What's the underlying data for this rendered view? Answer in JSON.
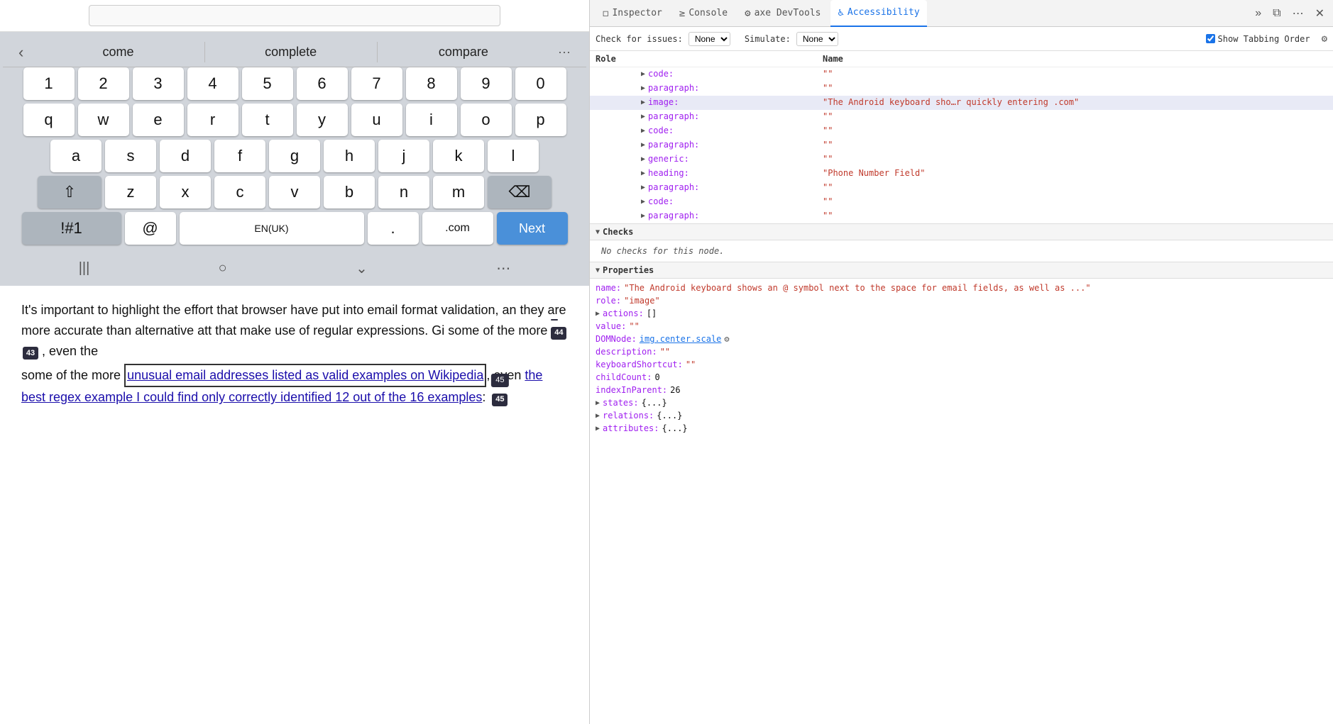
{
  "left": {
    "autocomplete": {
      "back_icon": "‹",
      "words": [
        "come",
        "complete",
        "compare"
      ],
      "more_icon": "···"
    },
    "keyboard": {
      "row1": [
        "1",
        "2",
        "3",
        "4",
        "5",
        "6",
        "7",
        "8",
        "9",
        "0"
      ],
      "row2": [
        "q",
        "w",
        "e",
        "r",
        "t",
        "y",
        "u",
        "i",
        "o",
        "p"
      ],
      "row3": [
        "a",
        "s",
        "d",
        "f",
        "g",
        "h",
        "j",
        "k",
        "l"
      ],
      "row4_special_left": "⇧",
      "row4": [
        "z",
        "x",
        "c",
        "v",
        "b",
        "n",
        "m"
      ],
      "row4_special_right": "⌫",
      "row5_special": "!#1",
      "row5_at": "@",
      "row5_space": "EN(UK)",
      "row5_dot": ".",
      "row5_dotcom": ".com",
      "row5_next": "Next"
    },
    "nav": {
      "lines": "|||",
      "circle": "○",
      "chevron": "⌄",
      "grid": "⋯"
    },
    "content": {
      "paragraph": "It's important to highlight the effort that browser have put into email format validation, an they are more accurate than alternative att that make use of regular expressions. Gi some of the more ",
      "link1": "unusual email addresses listed as valid examples on Wikipedia",
      "middle": ", even the",
      "link2": "best regex example I could find only correctly identified 12 out of the 16 examples",
      "end": ":",
      "tab_badges": [
        {
          "value": "44",
          "tooltip": ""
        },
        {
          "value": "43",
          "tooltip": ""
        },
        {
          "value": "45",
          "tooltip": ""
        }
      ]
    }
  },
  "devtools": {
    "tabs": [
      {
        "label": "Inspector",
        "icon": "◻",
        "active": false
      },
      {
        "label": "Console",
        "icon": "≥",
        "active": false
      },
      {
        "label": "axe DevTools",
        "icon": "⚙",
        "active": false
      },
      {
        "label": "Accessibility",
        "icon": "♿",
        "active": true
      }
    ],
    "toolbar": {
      "check_label": "Check for issues:",
      "check_value": "None",
      "simulate_label": "Simulate:",
      "simulate_value": "None",
      "show_tabbing_label": "Show Tabbing Order",
      "show_tabbing_checked": true
    },
    "tree": {
      "header_role": "Role",
      "header_name": "Name",
      "rows": [
        {
          "indent": 6,
          "expanded": false,
          "role": "code:",
          "name": "\"\""
        },
        {
          "indent": 6,
          "expanded": false,
          "role": "paragraph:",
          "name": "\"\""
        },
        {
          "indent": 6,
          "expanded": false,
          "role": "image:",
          "name": "\"The Android keyboard sho…r quickly entering .com\"",
          "highlighted": true
        },
        {
          "indent": 6,
          "expanded": false,
          "role": "paragraph:",
          "name": "\"\""
        },
        {
          "indent": 6,
          "expanded": false,
          "role": "code:",
          "name": "\"\""
        },
        {
          "indent": 6,
          "expanded": false,
          "role": "paragraph:",
          "name": "\"\""
        },
        {
          "indent": 6,
          "expanded": false,
          "role": "generic:",
          "name": "\"\""
        },
        {
          "indent": 6,
          "expanded": false,
          "role": "heading:",
          "name": "\"Phone Number Field\""
        },
        {
          "indent": 6,
          "expanded": false,
          "role": "paragraph:",
          "name": "\"\""
        },
        {
          "indent": 6,
          "expanded": false,
          "role": "code:",
          "name": "\"\""
        },
        {
          "indent": 6,
          "expanded": false,
          "role": "paragraph:",
          "name": "\"\""
        }
      ]
    },
    "checks": {
      "title": "Checks",
      "empty_message": "No checks for this node."
    },
    "properties": {
      "title": "Properties",
      "items": [
        {
          "key": "name:",
          "value": "\"The Android keyboard shows an @ symbol next to the space for email fields, as well as ...\"",
          "type": "red"
        },
        {
          "key": "role:",
          "value": "\"image\"",
          "type": "red"
        },
        {
          "key": "actions:",
          "value": "[]",
          "type": "expandable"
        },
        {
          "key": "value:",
          "value": "\"\"",
          "type": "red"
        },
        {
          "key": "DOMNode:",
          "value": "img.center.scale",
          "type": "blue-link"
        },
        {
          "key": "description:",
          "value": "\"\"",
          "type": "red"
        },
        {
          "key": "keyboardShortcut:",
          "value": "\"\"",
          "type": "red"
        },
        {
          "key": "childCount:",
          "value": "0",
          "type": "black"
        },
        {
          "key": "indexInParent:",
          "value": "26",
          "type": "black"
        },
        {
          "key": "states:",
          "value": "{...}",
          "type": "expandable"
        },
        {
          "key": "relations:",
          "value": "{...}",
          "type": "expandable"
        },
        {
          "key": "attributes:",
          "value": "{...}",
          "type": "expandable"
        }
      ]
    }
  }
}
